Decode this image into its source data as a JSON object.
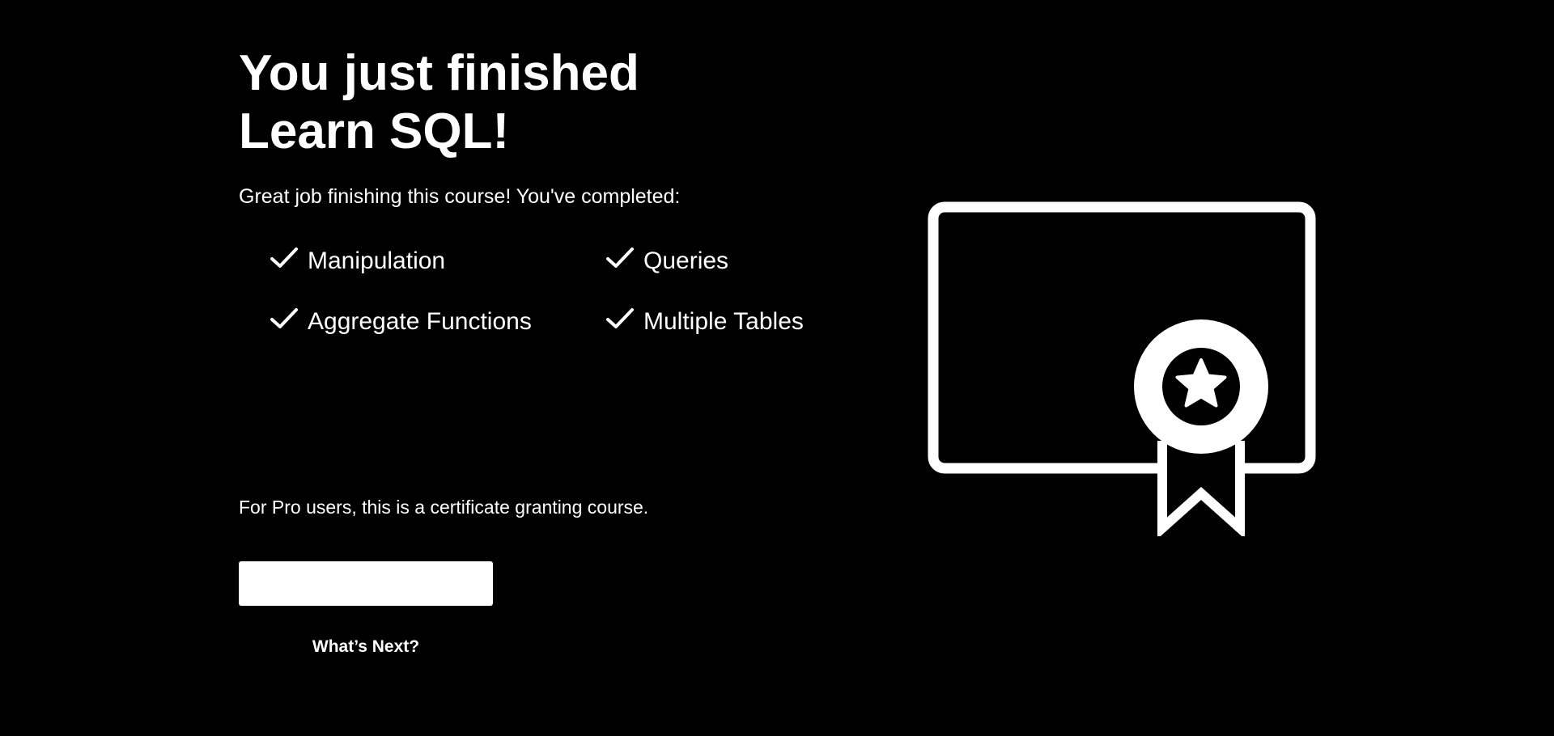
{
  "heading": {
    "line1": "You just finished",
    "line2": "Learn SQL!"
  },
  "intro": "Great job finishing this course! You've completed:",
  "completed_modules": [
    {
      "label": "Manipulation",
      "icon": "check-icon"
    },
    {
      "label": "Queries",
      "icon": "check-icon"
    },
    {
      "label": "Aggregate Functions",
      "icon": "check-icon"
    },
    {
      "label": "Multiple Tables",
      "icon": "check-icon"
    }
  ],
  "pro_note": "For Pro users, this is a certificate granting course.",
  "primary_button": {
    "label": ""
  },
  "next_link": {
    "label": "What’s Next?"
  },
  "illustration": {
    "icon": "certificate-icon"
  },
  "colors": {
    "background": "#000000",
    "foreground": "#ffffff"
  }
}
